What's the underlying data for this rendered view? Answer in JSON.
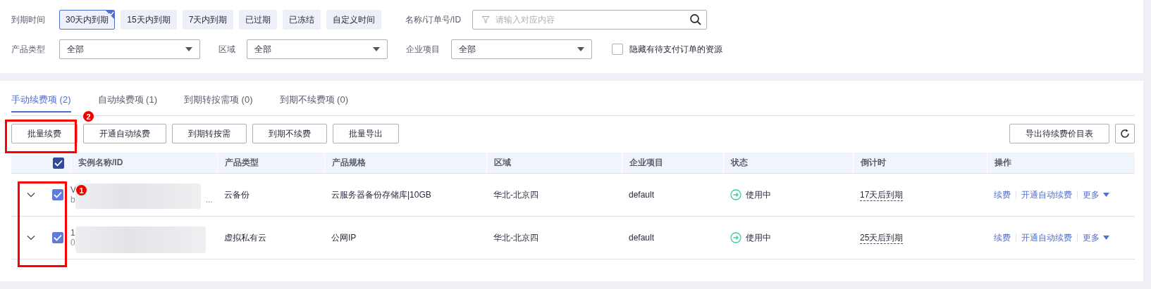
{
  "filters": {
    "expiry": {
      "label": "到期时间",
      "options": [
        {
          "label": "30天内到期",
          "selected": true
        },
        {
          "label": "15天内到期",
          "selected": false
        },
        {
          "label": "7天内到期",
          "selected": false
        },
        {
          "label": "已过期",
          "selected": false
        },
        {
          "label": "已冻结",
          "selected": false
        },
        {
          "label": "自定义时间",
          "selected": false
        }
      ]
    },
    "search": {
      "label": "名称/订单号/ID",
      "placeholder": "请输入对应内容"
    },
    "selects": [
      {
        "label": "产品类型",
        "value": "全部"
      },
      {
        "label": "区域",
        "value": "全部"
      },
      {
        "label": "企业项目",
        "value": "全部"
      }
    ],
    "hide_unpaid": {
      "label": "隐藏有待支付订单的资源",
      "checked": false
    }
  },
  "tabs": [
    {
      "label": "手动续费项 (2)",
      "selected": true
    },
    {
      "label": "自动续费项 (1)",
      "selected": false
    },
    {
      "label": "到期转按需项 (0)",
      "selected": false
    },
    {
      "label": "到期不续费项 (0)",
      "selected": false
    }
  ],
  "toolbar": {
    "buttons": [
      "批量续费",
      "开通自动续费",
      "到期转按需",
      "到期不续费",
      "批量导出"
    ],
    "export_button": "导出待续费价目表"
  },
  "table": {
    "header_checked": true,
    "columns": [
      "实例名称/ID",
      "产品类型",
      "产品规格",
      "区域",
      "企业项目",
      "状态",
      "倒计时",
      "操作"
    ],
    "rows": [
      {
        "checked": true,
        "expanded": false,
        "name": "V",
        "id": "b",
        "id_tail": "...",
        "product_type": "云备份",
        "spec": "云服务器备份存储库|10GB",
        "region": "华北-北京四",
        "project": "default",
        "status": "使用中",
        "countdown": "17天后到期",
        "actions": [
          "续费",
          "开通自动续费"
        ],
        "more": "更多"
      },
      {
        "checked": true,
        "expanded": false,
        "name": "1",
        "id": "0",
        "product_type": "虚拟私有云",
        "spec": "公网IP",
        "region": "华北-北京四",
        "project": "default",
        "status": "使用中",
        "countdown": "25天后到期",
        "actions": [
          "续费",
          "开通自动续费"
        ],
        "more": "更多"
      }
    ]
  },
  "annotations": [
    {
      "label": "1"
    },
    {
      "label": "2"
    }
  ]
}
